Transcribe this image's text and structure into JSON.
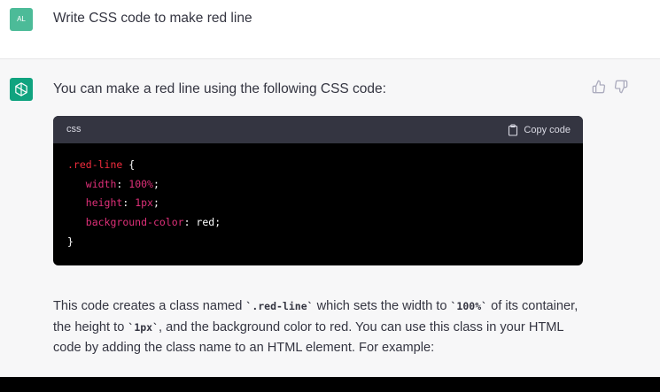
{
  "user_message": {
    "avatar_initials": "AL",
    "avatar_color": "#4cbb98",
    "text": "Write CSS code to make red line"
  },
  "assistant_message": {
    "avatar_icon": "openai-logo-icon",
    "avatar_color": "#10a37f",
    "intro": "You can make a red line using the following CSS code:",
    "feedback": {
      "thumbs_up_icon": "thumbs-up-icon",
      "thumbs_down_icon": "thumbs-down-icon"
    },
    "code_block": {
      "language": "css",
      "copy_label": "Copy code",
      "copy_icon": "clipboard-icon",
      "lines": {
        "l1_selector": ".red-line",
        "l1_brace": " {",
        "l2_prop": "width",
        "l2_colon": ": ",
        "l2_value": "100%",
        "l2_semi": ";",
        "l3_prop": "height",
        "l3_colon": ": ",
        "l3_value": "1px",
        "l3_semi": ";",
        "l4_prop": "background-color",
        "l4_colon": ": ",
        "l4_value": "red",
        "l4_semi": ";",
        "l5_brace": "}"
      }
    },
    "paragraph": {
      "p1": "This code creates a class named ",
      "c1": "`.red-line`",
      "p2": " which sets the width to ",
      "c2": "`100%`",
      "p3": " of its container, the height to ",
      "c3": "`1px`",
      "p4": ", and the background color to red. You can use this class in your HTML code by adding the class name to an HTML element. For example:"
    }
  }
}
